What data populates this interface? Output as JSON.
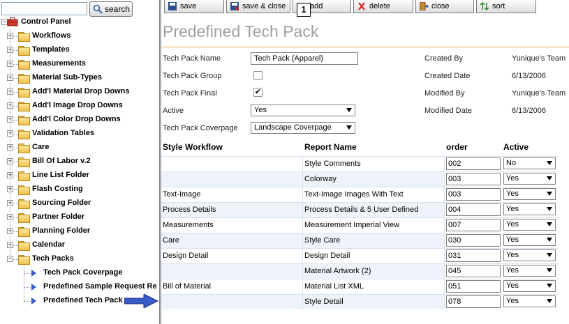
{
  "search": {
    "button_label": "search",
    "value": ""
  },
  "tree": {
    "root": "Control Panel",
    "items": [
      {
        "label": "Workflows"
      },
      {
        "label": "Templates"
      },
      {
        "label": "Measurements"
      },
      {
        "label": "Material Sub-Types"
      },
      {
        "label": "Add'l Material Drop Downs"
      },
      {
        "label": "Add'l Image Drop Downs"
      },
      {
        "label": "Add'l Color Drop Downs"
      },
      {
        "label": "Validation Tables"
      },
      {
        "label": "Care"
      },
      {
        "label": "Bill Of Labor v.2"
      },
      {
        "label": "Line List Folder"
      },
      {
        "label": "Flash Costing"
      },
      {
        "label": "Sourcing Folder"
      },
      {
        "label": "Partner Folder"
      },
      {
        "label": "Planning Folder"
      },
      {
        "label": "Calendar"
      },
      {
        "label": "Tech Packs"
      }
    ],
    "children": [
      {
        "label": "Tech Pack Coverpage"
      },
      {
        "label": "Predefined Sample Request Re"
      },
      {
        "label": "Predefined Tech Pack"
      }
    ]
  },
  "toolbar": {
    "save": "save",
    "save_close": "save & close",
    "add": "add",
    "delete": "delete",
    "close": "close",
    "sort": "sort",
    "badge": "1"
  },
  "page": {
    "title": "Predefined Tech Pack"
  },
  "form": {
    "name_label": "Tech Pack Name",
    "name_value": "Tech Pack (Apparel)",
    "group_label": "Tech Pack Group",
    "final_label": "Tech Pack Final",
    "final_checked": "✔",
    "active_label": "Active",
    "active_value": "Yes",
    "coverpage_label": "Tech Pack Coverpage",
    "coverpage_value": "Landscape Coverpage",
    "created_by_label": "Created By",
    "created_by_value": "Yunique's Team",
    "created_date_label": "Created Date",
    "created_date_value": "6/13/2006",
    "modified_by_label": "Modified By",
    "modified_by_value": "Yunique's Team",
    "modified_date_label": "Modified Date",
    "modified_date_value": "6/13/2006"
  },
  "grid": {
    "headers": {
      "workflow": "Style Workflow",
      "report": "Report Name",
      "order": "order",
      "active": "Active"
    },
    "rows": [
      {
        "workflow": "",
        "report": "Style Comments",
        "order": "002",
        "active": "No"
      },
      {
        "workflow": "",
        "report": "Colorway",
        "order": "003",
        "active": "Yes"
      },
      {
        "workflow": "Text-Image",
        "report": "Text-Image Images With Text",
        "order": "003",
        "active": "Yes"
      },
      {
        "workflow": "Process Details",
        "report": "Process Details & 5 User Defined",
        "order": "004",
        "active": "Yes"
      },
      {
        "workflow": "Measurements",
        "report": "Measurement Imperial View",
        "order": "007",
        "active": "Yes"
      },
      {
        "workflow": "Care",
        "report": "Style Care",
        "order": "030",
        "active": "Yes"
      },
      {
        "workflow": "Design Detail",
        "report": "Design Detail",
        "order": "031",
        "active": "Yes"
      },
      {
        "workflow": "",
        "report": "Material Artwork (2)",
        "order": "045",
        "active": "Yes"
      },
      {
        "workflow": "Bill of Material",
        "report": "Material List XML",
        "order": "051",
        "active": "Yes"
      },
      {
        "workflow": "",
        "report": "Style Detail",
        "order": "078",
        "active": "Yes"
      }
    ]
  },
  "colors": {
    "row_alt": "#eef3fa",
    "title_rule": "#e0b24a",
    "arrow": "#3a5bc7"
  }
}
